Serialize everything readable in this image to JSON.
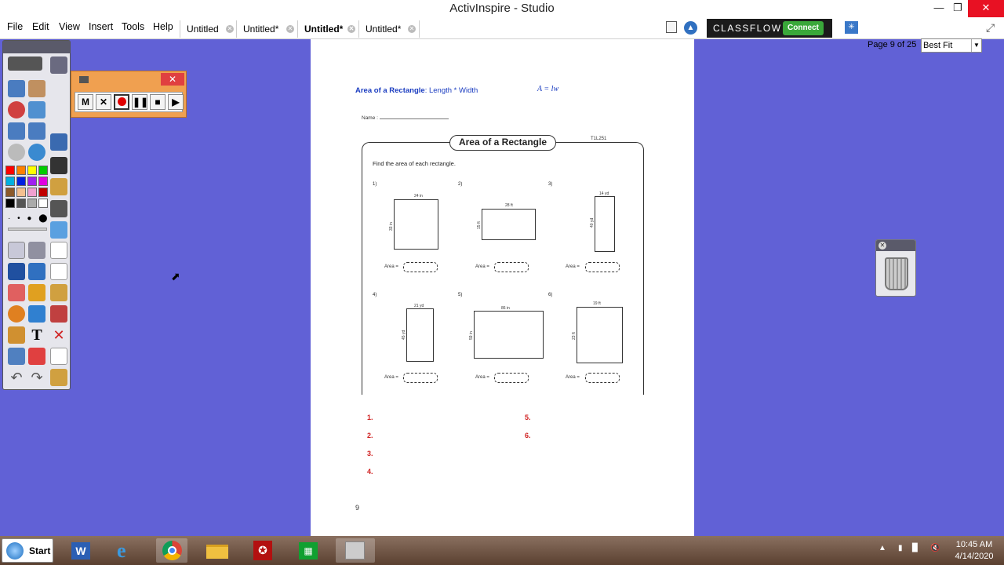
{
  "window": {
    "title": "ActivInspire - Studio"
  },
  "menu": {
    "items": [
      "File",
      "Edit",
      "View",
      "Insert",
      "Tools",
      "Help"
    ]
  },
  "tabs": [
    {
      "label": "Untitled",
      "active": false
    },
    {
      "label": "Untitled*",
      "active": false
    },
    {
      "label": "Untitled*",
      "active": true
    },
    {
      "label": "Untitled*",
      "active": false
    }
  ],
  "classflow": {
    "brand": "CLASSFLOW",
    "connect_label": "Connect"
  },
  "page_info": "Page 9 of 25",
  "zoom": {
    "selected": "Best Fit"
  },
  "recorder": {
    "mute_label": "M"
  },
  "worksheet": {
    "heading_bold": "Area of a Rectangle",
    "heading_rest": ": Length * Width",
    "formula": "A = lw",
    "name_label": "Name :",
    "title": "Area of a Rectangle",
    "code": "T1L251",
    "instructions": "Find the area of each rectangle.",
    "area_label": "Area =",
    "problems": [
      {
        "num": "1)",
        "length": "24 in",
        "width": "33 in"
      },
      {
        "num": "2)",
        "length": "28 ft",
        "width": "15 ft"
      },
      {
        "num": "3)",
        "length": "14 yd",
        "width": "40 yd"
      },
      {
        "num": "4)",
        "length": "21 yd",
        "width": "45 yd"
      },
      {
        "num": "5)",
        "length": "86 in",
        "width": "59 in"
      },
      {
        "num": "6)",
        "length": "19 ft",
        "width": "23 ft"
      }
    ],
    "answers_left": [
      "1.",
      "2.",
      "3.",
      "4."
    ],
    "answers_right": [
      "5.",
      "6."
    ],
    "page_number": "9"
  },
  "taskbar": {
    "start_label": "Start",
    "clock_time": "10:45 AM",
    "clock_date": "4/14/2020"
  },
  "colors": {
    "background": "#6161d6",
    "accent_red": "#d02020",
    "link_blue": "#1a3cc0"
  }
}
